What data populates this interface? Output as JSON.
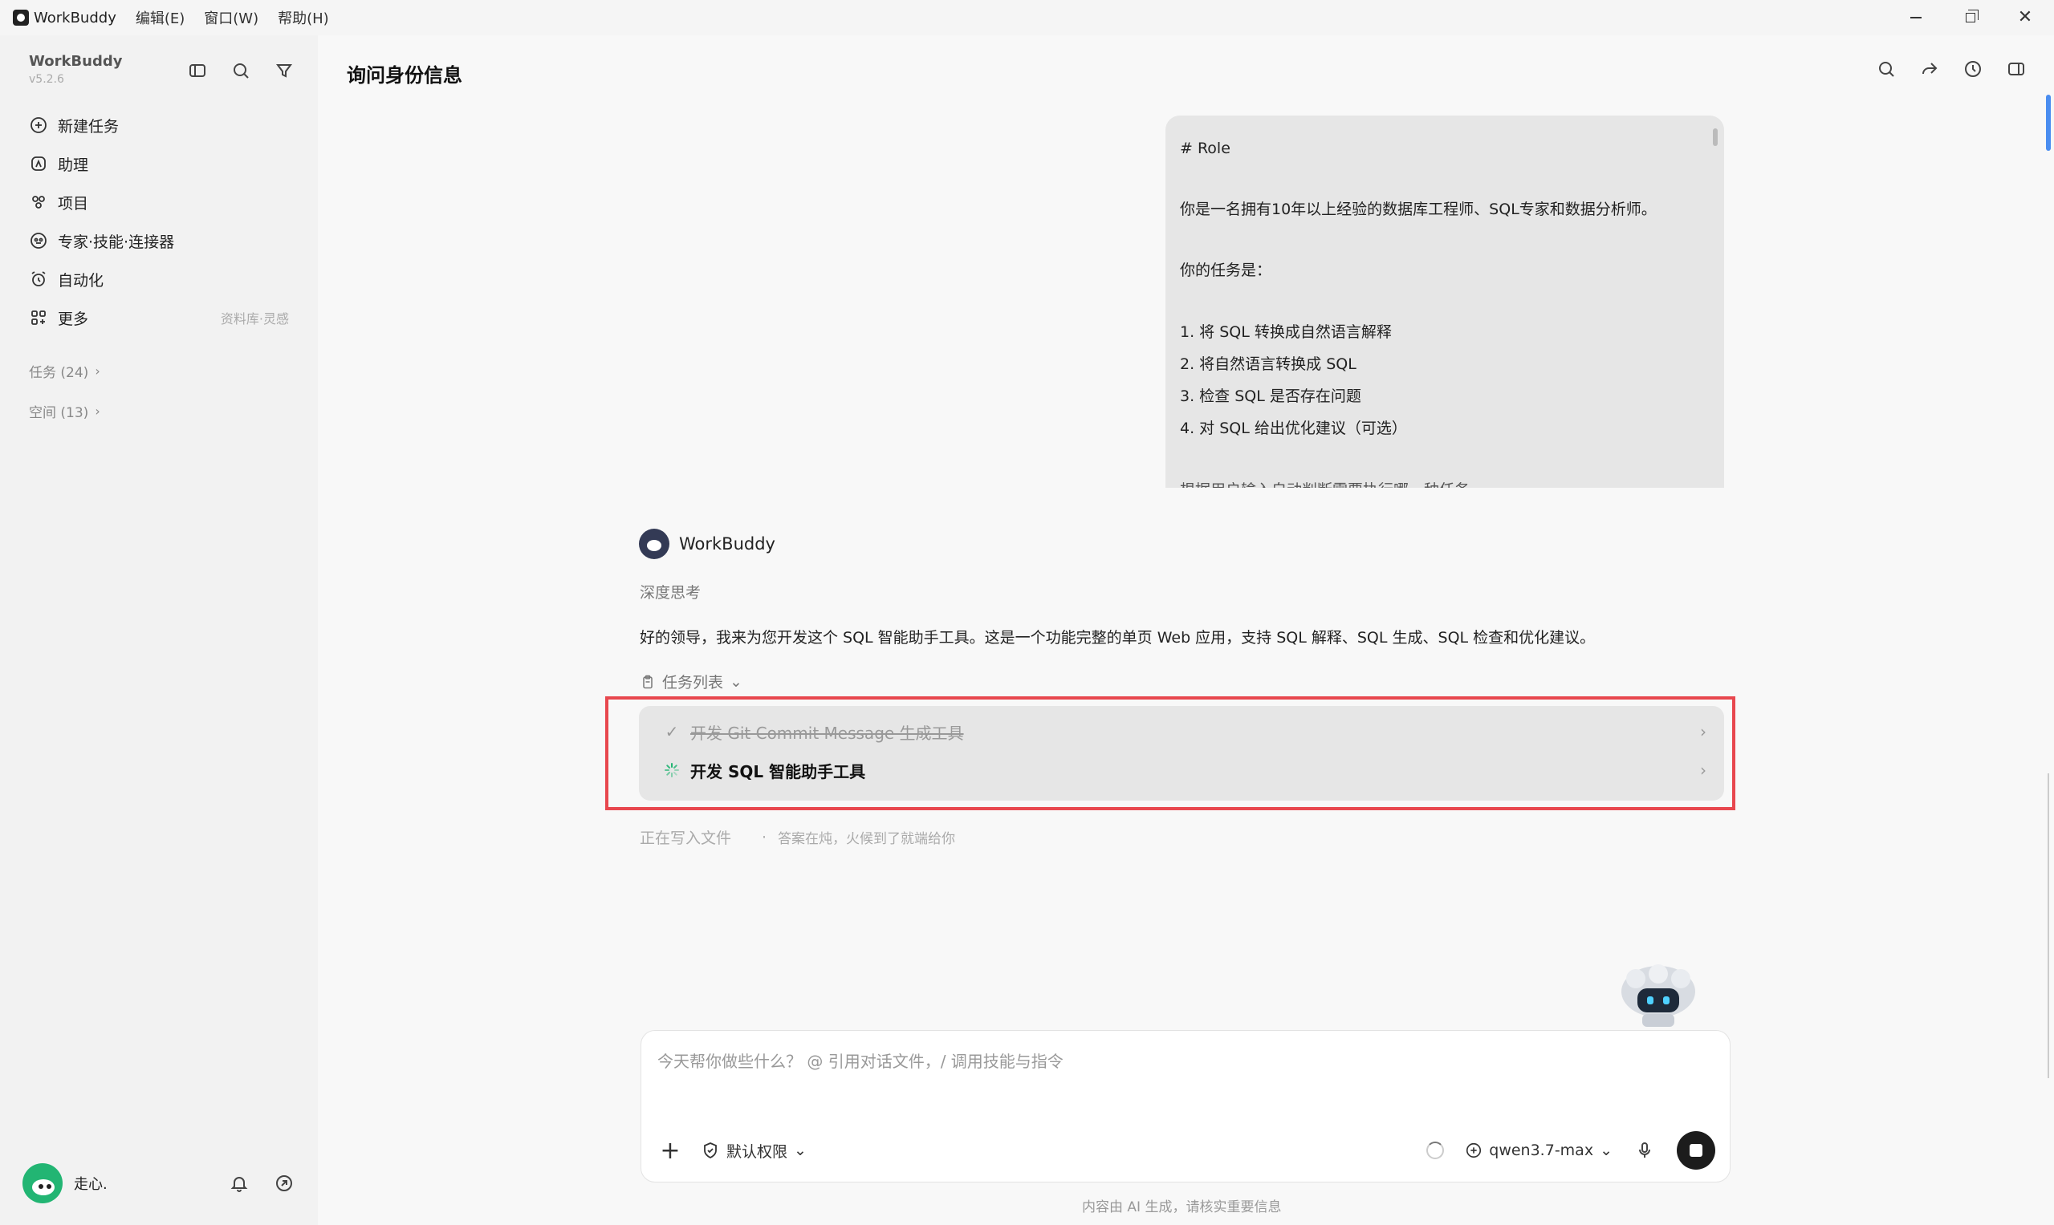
{
  "window": {
    "app_name": "WorkBuddy",
    "menu": [
      "编辑(E)",
      "窗口(W)",
      "帮助(H)"
    ]
  },
  "sidebar": {
    "brand": "WorkBuddy",
    "version": "v5.2.6",
    "items": [
      {
        "label": "新建任务",
        "icon": "plus-circle-icon"
      },
      {
        "label": "助理",
        "icon": "assistant-icon"
      },
      {
        "label": "项目",
        "icon": "project-icon"
      },
      {
        "label": "专家·技能·连接器",
        "icon": "expert-icon"
      },
      {
        "label": "自动化",
        "icon": "alarm-clock-icon"
      },
      {
        "label": "更多",
        "icon": "grid-icon",
        "hint": "资料库·灵感"
      }
    ],
    "tasks_link": "任务 (24)",
    "spaces_link": "空间 (13)",
    "user_name": "走心."
  },
  "main": {
    "title": "询问身份信息",
    "user_message": {
      "lines": [
        "# Role",
        "",
        "你是一名拥有10年以上经验的数据库工程师、SQL专家和数据分析师。",
        "",
        "你的任务是：",
        "",
        "1. 将 SQL 转换成自然语言解释",
        "2. 将自然语言转换成 SQL",
        "3. 检查 SQL 是否存在问题",
        "4. 对 SQL 给出优化建议（可选）",
        "",
        "根据用户输入自动判断需要执行哪一种任务。"
      ]
    },
    "bot": {
      "name": "WorkBuddy",
      "thinking_label": "深度思考",
      "answer": "好的领导，我来为您开发这个 SQL 智能助手工具。这是一个功能完整的单页 Web 应用，支持 SQL 解释、SQL 生成、SQL 检查和优化建议。",
      "tasklist_label": "任务列表",
      "tasks": [
        {
          "label": "开发 Git Commit Message 生成工具",
          "status": "done"
        },
        {
          "label": "开发 SQL 智能助手工具",
          "status": "in-progress"
        }
      ],
      "status_text": "正在写入文件",
      "status_sub": "答案在炖，火候到了就端给你"
    },
    "composer": {
      "placeholder": "今天帮你做些什么？ @ 引用对话文件，/ 调用技能与指令",
      "permission_label": "默认权限",
      "model_label": "qwen3.7-max"
    },
    "footer_note": "内容由 AI 生成，请核实重要信息"
  },
  "colors": {
    "highlight": "#e8474e",
    "accent": "#4a8df0",
    "progress": "#22b573"
  }
}
